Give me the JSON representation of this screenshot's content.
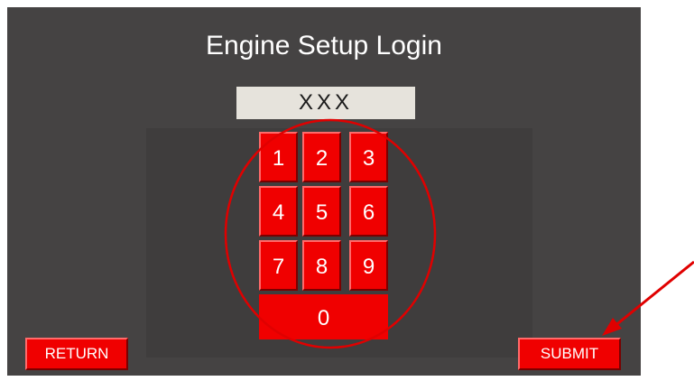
{
  "title": "Engine Setup Login",
  "display": {
    "value": "XXX"
  },
  "keypad": {
    "k1": "1",
    "k2": "2",
    "k3": "3",
    "k4": "4",
    "k5": "5",
    "k6": "6",
    "k7": "7",
    "k8": "8",
    "k9": "9",
    "k0": "0"
  },
  "buttons": {
    "return_label": "RETURN",
    "submit_label": "SUBMIT"
  },
  "colors": {
    "screen_bg": "#454343",
    "key_red": "#f00000",
    "display_bg": "#e6e3dc",
    "annotation_red": "#e00000"
  }
}
